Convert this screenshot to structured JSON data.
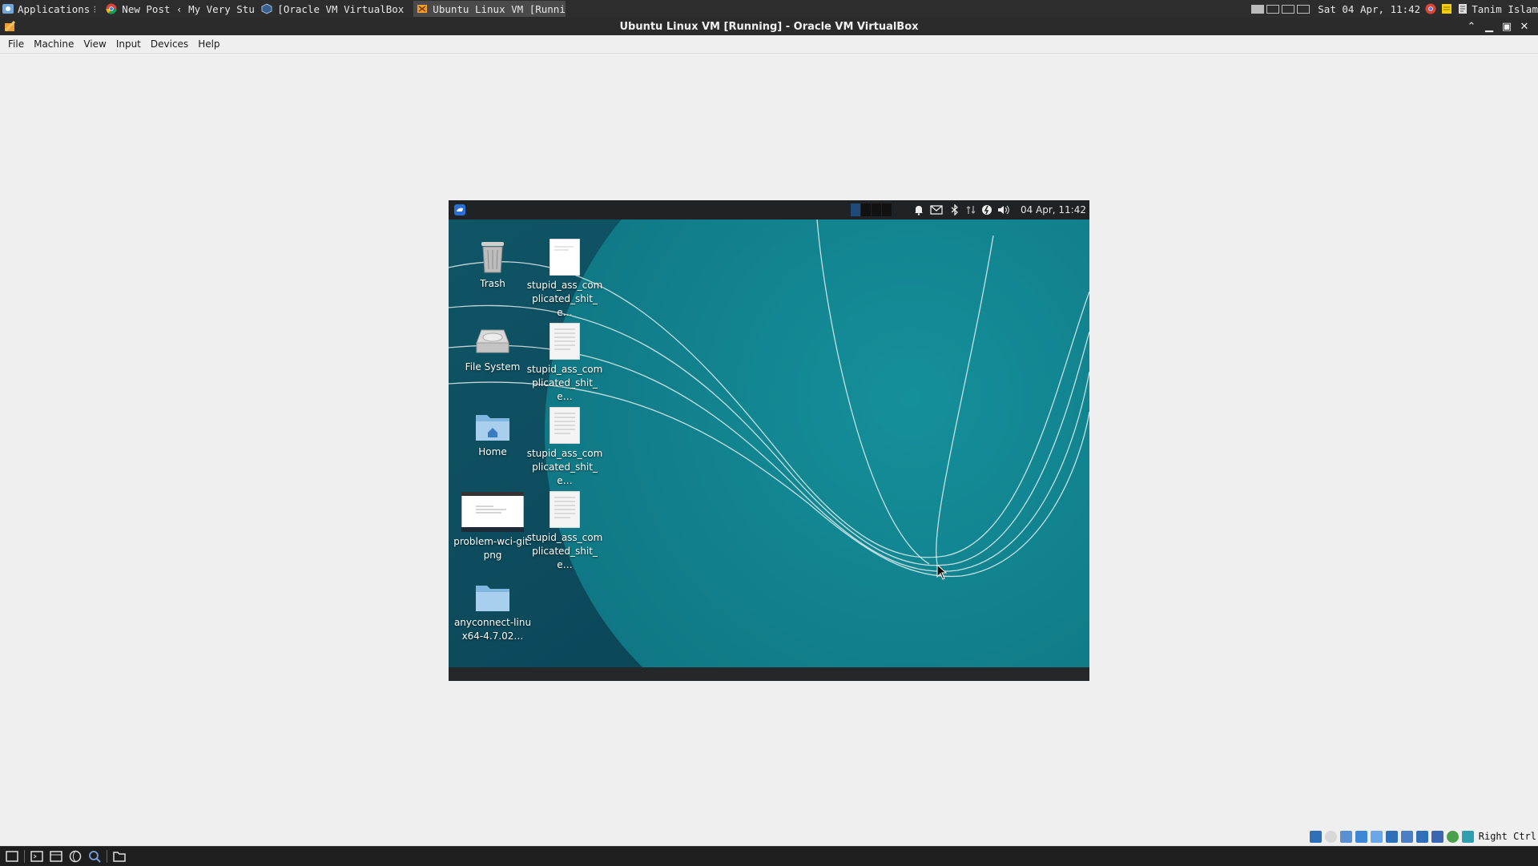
{
  "host_panel": {
    "applications_label": "Applications",
    "tasks": [
      {
        "label": "New Post ‹ My Very Stup…",
        "icon": "chrome-icon"
      },
      {
        "label": "[Oracle VM VirtualBox M…",
        "icon": "virtualbox-icon"
      },
      {
        "label": "Ubuntu Linux VM [Runnin…",
        "icon": "virtualbox-icon",
        "active": true
      }
    ],
    "clock": "Sat 04 Apr, 11:42",
    "user": "Tanim Islam"
  },
  "vbox": {
    "title": "Ubuntu Linux VM [Running] - Oracle VM VirtualBox",
    "menu": [
      "File",
      "Machine",
      "View",
      "Input",
      "Devices",
      "Help"
    ],
    "status_hostkey": "Right Ctrl"
  },
  "guest": {
    "panel_clock": "04 Apr, 11:42",
    "desktop_icons": [
      {
        "label": "Trash",
        "icon": "trash-icon"
      },
      {
        "label": "File System",
        "icon": "drive-icon"
      },
      {
        "label": "Home",
        "icon": "home-folder-icon"
      },
      {
        "label": "problem-wci-git.png",
        "icon": "image-thumbnail-icon"
      },
      {
        "label": "anyconnect-linux64-4.7.02…",
        "icon": "folder-icon"
      },
      {
        "label": "stupid_ass_complicated_shit_e…",
        "icon": "document-icon"
      },
      {
        "label": "stupid_ass_complicated_shit_e…",
        "icon": "document-icon"
      },
      {
        "label": "stupid_ass_complicated_shit_e…",
        "icon": "document-icon"
      },
      {
        "label": "stupid_ass_complicated_shit_e…",
        "icon": "document-icon"
      }
    ]
  },
  "colors": {
    "wallpaper_teal": "#15929a",
    "wallpaper_dark": "#0c4a5c",
    "panel_dark": "#2d2d2d"
  }
}
